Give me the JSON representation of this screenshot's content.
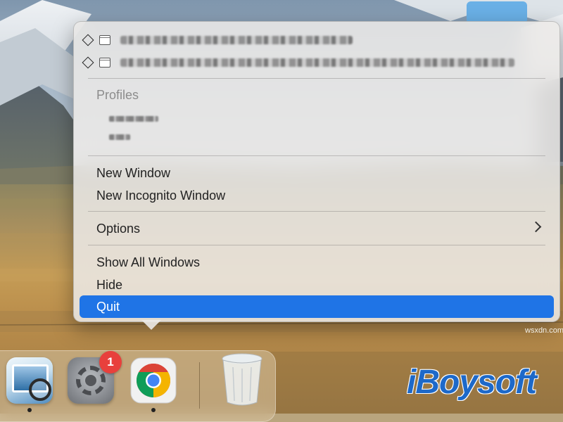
{
  "menu": {
    "windows": [
      {
        "title_visible": false
      },
      {
        "title_visible": false
      }
    ],
    "profiles_header": "Profiles",
    "items": {
      "new_window": "New Window",
      "new_incognito": "New Incognito Window",
      "options": "Options",
      "show_all": "Show All Windows",
      "hide": "Hide",
      "quit": "Quit"
    },
    "selected_item": "Quit",
    "selection_color": "#1f74e6"
  },
  "dock": {
    "apps": [
      {
        "name": "Preview",
        "icon": "preview-icon"
      },
      {
        "name": "System Settings",
        "icon": "system-settings-icon",
        "badge": "1"
      },
      {
        "name": "Google Chrome",
        "icon": "chrome-icon"
      },
      {
        "name": "Trash",
        "icon": "trash-icon"
      }
    ],
    "badge_color": "#e8403c"
  },
  "watermark": {
    "text": "iBoysoft",
    "color": "#1d69c9"
  },
  "site_mark": "wsxdn.com"
}
